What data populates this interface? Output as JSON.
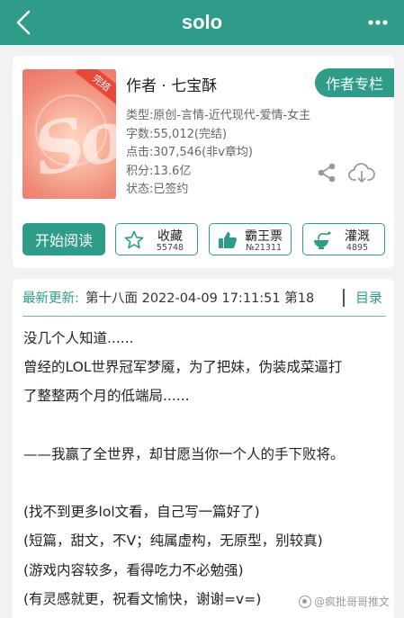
{
  "header": {
    "title": "solo"
  },
  "book": {
    "author": "作者 · 七宝酥",
    "author_column_label": "作者专栏",
    "finished_badge": "完结",
    "meta": [
      "类型:原创-言情-近代现代-爱情-女主",
      "字数:55,012(完结)",
      "点击:307,546(非ⅴ章均)",
      "积分:13.6亿",
      "状态:已签约"
    ]
  },
  "actions": {
    "read_label": "开始阅读",
    "favorite": {
      "label": "收藏",
      "count": "55748"
    },
    "overlord": {
      "label": "霸王票",
      "count": "№21311"
    },
    "water": {
      "label": "灌溉",
      "count": "4895"
    }
  },
  "chapter": {
    "latest_label": "最新更新:",
    "latest_text": " 第十八面 2022-04-09 17:11:51  第18",
    "catalog_label": "目录"
  },
  "synopsis": [
    "没几个人知道......",
    "曾经的LOL世界冠军梦魇，为了把妹，伪装成菜逼打",
    "了整整两个月的低端局......",
    "",
    "——我赢了全世界，却甘愿当你一个人的手下败将。",
    "",
    "(找不到更多lol文看，自己写一篇好了)",
    "(短篇，甜文，不V；纯属虚构，无原型，别较真)",
    "(游戏内容较多，看得吃力不必勉强)",
    "(有灵感就更，祝看文愉快，谢谢=v=)"
  ],
  "watermark": "@疯批哥哥推文",
  "colors": {
    "brand": "#2e9c89",
    "badge": "#e8483a"
  }
}
